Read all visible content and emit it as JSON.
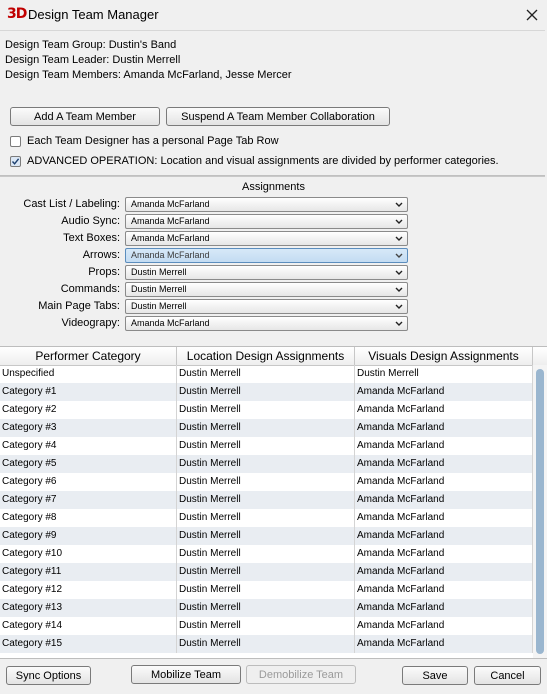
{
  "window": {
    "logo": "3D",
    "title": "Design Team Manager"
  },
  "info": {
    "group": "Design Team Group: Dustin's Band",
    "leader": "Design Team Leader: Dustin Merrell",
    "members": "Design Team Members: Amanda McFarland, Jesse Mercer"
  },
  "actions": {
    "add_member": "Add A Team Member",
    "suspend_member": "Suspend A Team Member Collaboration"
  },
  "options": {
    "personal_tab": {
      "label": "Each Team Designer has a personal Page Tab Row",
      "checked": false
    },
    "advanced": {
      "label": "ADVANCED OPERATION: Location and visual assignments are divided by performer categories.",
      "checked": true
    }
  },
  "assignments": {
    "title": "Assignments",
    "rows": [
      {
        "label": "Cast List / Labeling:",
        "value": "Amanda McFarland"
      },
      {
        "label": "Audio Sync:",
        "value": "Amanda McFarland"
      },
      {
        "label": "Text Boxes:",
        "value": "Amanda McFarland"
      },
      {
        "label": "Arrows:",
        "value": "Amanda McFarland"
      },
      {
        "label": "Props:",
        "value": "Dustin Merrell"
      },
      {
        "label": "Commands:",
        "value": "Dustin Merrell"
      },
      {
        "label": "Main Page Tabs:",
        "value": "Dustin Merrell"
      },
      {
        "label": "Videograpy:",
        "value": "Amanda McFarland"
      }
    ]
  },
  "table": {
    "columns": [
      "Performer Category",
      "Location Design Assignments",
      "Visuals Design Assignments"
    ],
    "rows": [
      [
        "Unspecified",
        "Dustin Merrell",
        "Dustin Merrell"
      ],
      [
        "Category #1",
        "Dustin Merrell",
        "Amanda McFarland"
      ],
      [
        "Category #2",
        "Dustin Merrell",
        "Amanda McFarland"
      ],
      [
        "Category #3",
        "Dustin Merrell",
        "Amanda McFarland"
      ],
      [
        "Category #4",
        "Dustin Merrell",
        "Amanda McFarland"
      ],
      [
        "Category #5",
        "Dustin Merrell",
        "Amanda McFarland"
      ],
      [
        "Category #6",
        "Dustin Merrell",
        "Amanda McFarland"
      ],
      [
        "Category #7",
        "Dustin Merrell",
        "Amanda McFarland"
      ],
      [
        "Category #8",
        "Dustin Merrell",
        "Amanda McFarland"
      ],
      [
        "Category #9",
        "Dustin Merrell",
        "Amanda McFarland"
      ],
      [
        "Category #10",
        "Dustin Merrell",
        "Amanda McFarland"
      ],
      [
        "Category #11",
        "Dustin Merrell",
        "Amanda McFarland"
      ],
      [
        "Category #12",
        "Dustin Merrell",
        "Amanda McFarland"
      ],
      [
        "Category #13",
        "Dustin Merrell",
        "Amanda McFarland"
      ],
      [
        "Category #14",
        "Dustin Merrell",
        "Amanda McFarland"
      ],
      [
        "Category #15",
        "Dustin Merrell",
        "Amanda McFarland"
      ]
    ]
  },
  "footer": {
    "sync_options": "Sync Options",
    "mobilize": "Mobilize Team",
    "demobilize": "Demobilize Team",
    "save": "Save",
    "cancel": "Cancel"
  }
}
